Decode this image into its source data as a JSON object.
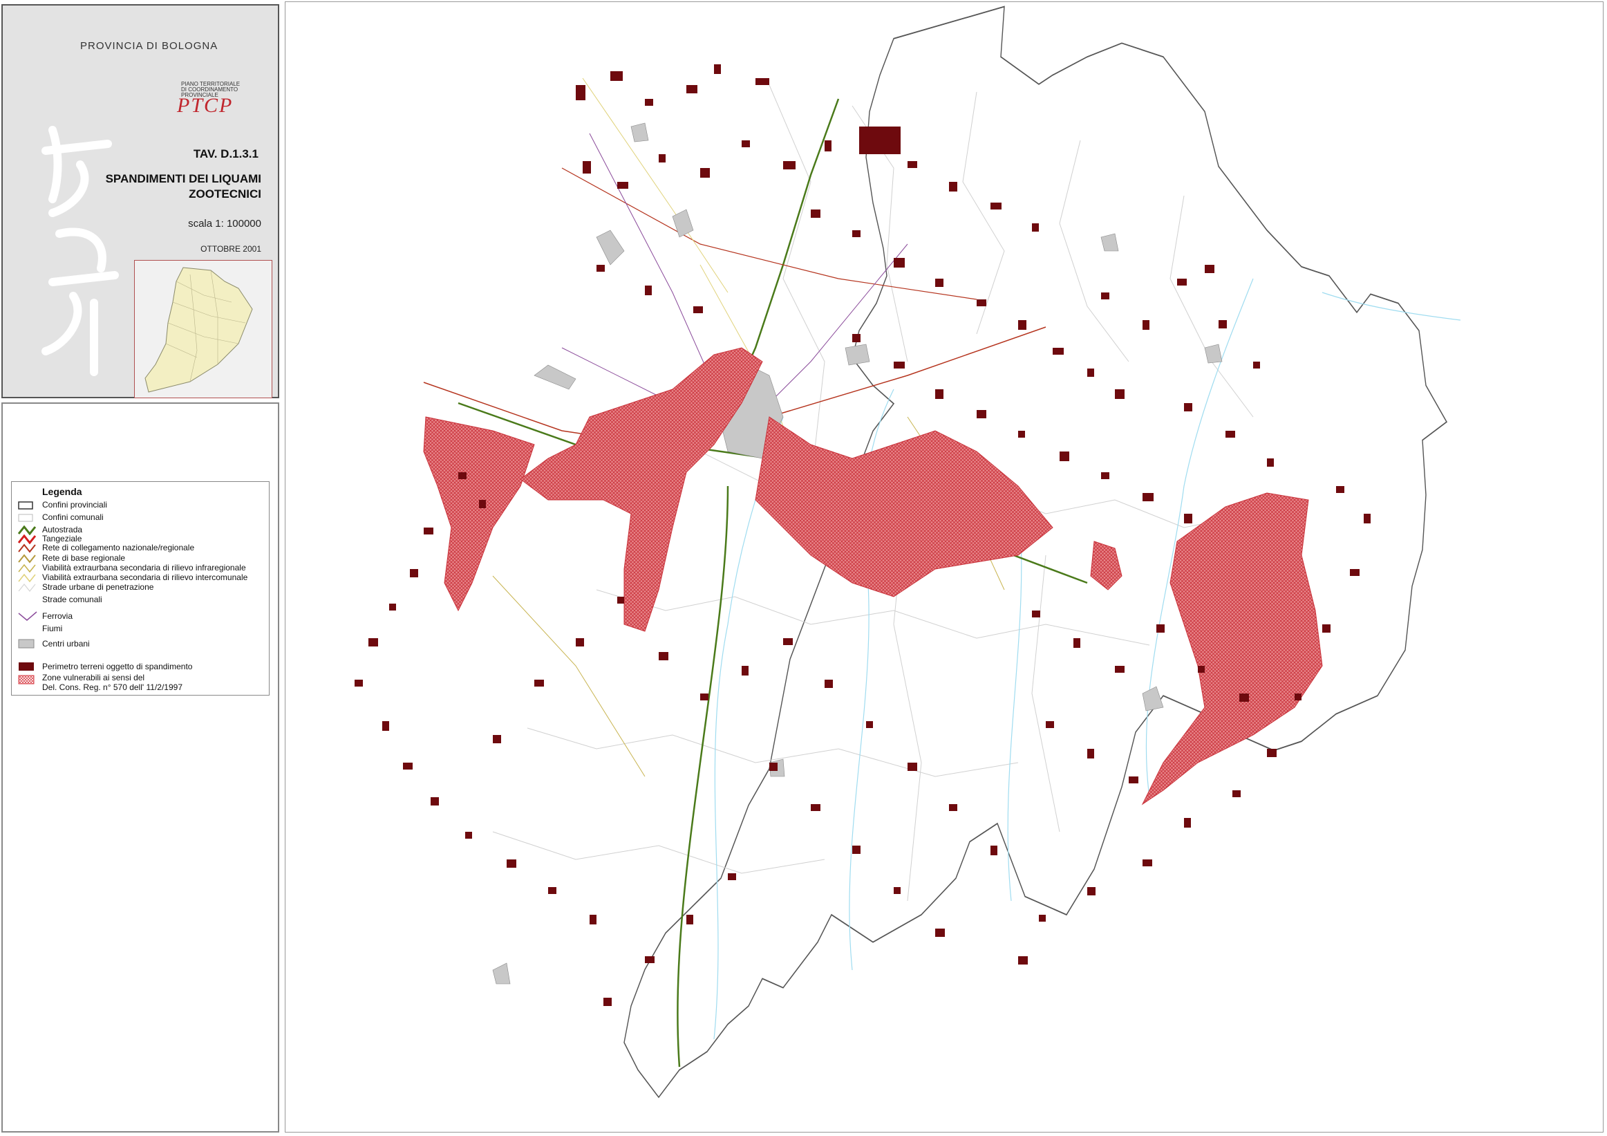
{
  "title_block": {
    "province": "PROVINCIA DI BOLOGNA",
    "ptcp_small": [
      "PIANO TERRITORIALE",
      "DI COORDINAMENTO",
      "PROVINCIALE"
    ],
    "logo_text": "PTCP",
    "tav": "TAV. D.1.3.1",
    "title_lines": [
      "SPANDIMENTI DEI LIQUAMI",
      "ZOOTECNICI"
    ],
    "scale": "scala 1: 100000",
    "date": "OTTOBRE 2001"
  },
  "legend": {
    "title": "Legenda",
    "items": [
      {
        "label": "Confini provinciali",
        "symbol": "rect-outline",
        "color": "#333333"
      },
      {
        "label": "Confini comunali",
        "symbol": "rect-outline-light",
        "color": "#bbbbbb"
      },
      {
        "label": "Autostrada",
        "symbol": "zigzag",
        "color": "#4a7a1a"
      },
      {
        "label": "Tangeziale",
        "symbol": "zigzag",
        "color": "#d41e1e"
      },
      {
        "label": "Rete di collegamento nazionale/regionale",
        "symbol": "zigzag",
        "color": "#b5341e"
      },
      {
        "label": "Rete di base regionale",
        "symbol": "zigzag",
        "color": "#b59a3c"
      },
      {
        "label": "Viabilità extraurbana secondaria di rilievo infraregionale",
        "symbol": "zigzag",
        "color": "#c8b450"
      },
      {
        "label": "Viabilità extraurbana secondaria di rilievo intercomunale",
        "symbol": "zigzag",
        "color": "#e0d27a"
      },
      {
        "label": "Strade urbane di penetrazione",
        "symbol": "zigzag",
        "color": "#d6d6d6"
      },
      {
        "label": "Strade comunali",
        "symbol": "none",
        "color": "#e6e6e6"
      },
      {
        "label": "Ferrovia",
        "symbol": "zigzag",
        "color": "#8a4a9a"
      },
      {
        "label": "Fiumi",
        "symbol": "none",
        "color": "#9fdcf0"
      },
      {
        "label": "Centri urbani",
        "symbol": "fill",
        "color": "#c8c8c8"
      },
      {
        "label": "Perimetro terreni oggetto di spandimento",
        "symbol": "fill",
        "color": "#6e0a0e"
      },
      {
        "label": "Zone vulnerabili ai sensi del\nDel. Cons. Reg. n° 570 dell' 11/2/1997",
        "symbol": "hatch",
        "color": "#d9434b"
      }
    ]
  },
  "colors": {
    "spandimento": "#6e0a0e",
    "vulnerable": "#d9434b",
    "urban": "#c8c8c8",
    "autostrada": "#4a7a1a",
    "tangenziale": "#d41e1e",
    "rivers": "#9fdcf0"
  }
}
